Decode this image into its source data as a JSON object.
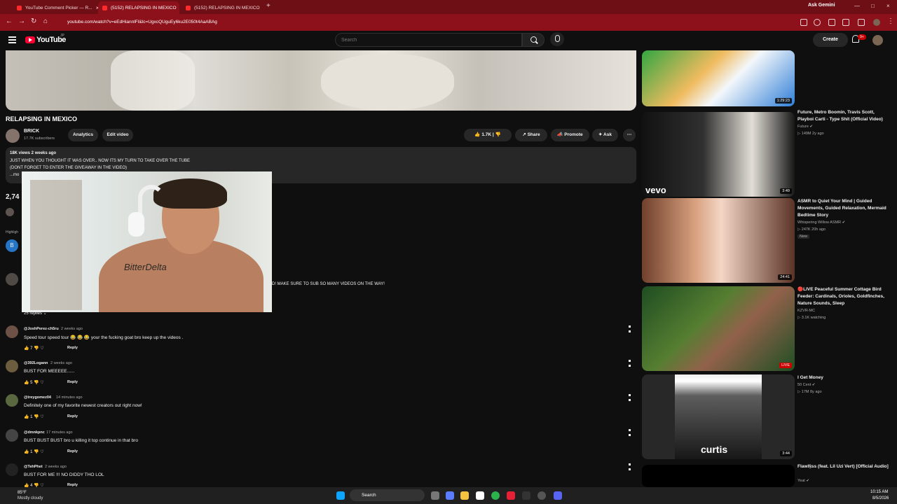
{
  "browser": {
    "tabs": [
      "YouTube Comment Picker — R...",
      "(5152) RELAPSING IN MEXICO",
      "(5152) RELAPSING IN MEXICO"
    ],
    "gemini": "Ask Gemini",
    "url": "youtube.com/watch?v=eEdHiannlFI&lc=UgxcQUguEy6ku2E050t4AaABAg",
    "new_tab": "+"
  },
  "youtube": {
    "logo": "YouTube",
    "logo_sup": "JP",
    "search_placeholder": "Search",
    "create": "Create",
    "notifications": "9+"
  },
  "video": {
    "title": "RELAPSING IN MEXICO",
    "channel": "BRICK",
    "subscribers": "17.7K subscribers",
    "actions": [
      "Analytics",
      "Edit video"
    ],
    "likes": "1.7K",
    "share": "Share",
    "promote": "Promote",
    "ask": "Ask"
  },
  "description": {
    "stats": "18K views  2 weeks ago",
    "line1": "JUST WHEN YOU THOUGHT IT WAS OVER.. NOW ITS MY TURN TO TAKE OVER THE TUBE",
    "line2": "(DONT FORGET TO ENTER THE GIVEAWAY IN THE VIDEO)",
    "more": "...mo"
  },
  "comments_fragment": {
    "count": "2,74",
    "highlighted": "Highligh",
    "avatar_letter": "B",
    "text": "D! MAKE SURE TO SUB SO MANY VIDEOS ON THE WAY!",
    "replies": "25 replies"
  },
  "comments": [
    {
      "author": "@JoshPerez-ch5ru",
      "time": "2 weeks ago",
      "text": "Speed tour speed tour 😂 😂 😂 your the fucking goat bro keep up the videos .",
      "likes": "7",
      "reply": "Reply"
    },
    {
      "author": "@392Logann",
      "time": "2 weeks ago",
      "text": "BUST FOR MEEEEE......",
      "likes": "5",
      "reply": "Reply"
    },
    {
      "author": "@treygomez04",
      "time": "14 minutes ago",
      "text": "Definitely one of my favorite newest creators out right now!",
      "likes": "1",
      "reply": "Reply"
    },
    {
      "author": "@dmnkpnc",
      "time": "17 minutes ago",
      "text": "BUST BUST BUST bro u killing it top continue in that bro",
      "likes": "1",
      "reply": "Reply"
    },
    {
      "author": "@TehPhet",
      "time": "2 weeks ago",
      "text": "BUST FOR ME !!! NO DIDDY THO LOL",
      "likes": "4",
      "reply": "Reply"
    }
  ],
  "recommendations": [
    {
      "title": "",
      "meta1": "",
      "meta2": "",
      "duration": "1:29:23"
    },
    {
      "title": "Future, Metro Boomin, Travis Scott, Playboi Carti - Type Shit (Official Video)",
      "meta1": "Future ✔",
      "meta2": "▷ 149M  2y ago",
      "duration": "3:49",
      "overlay": "vevo"
    },
    {
      "title": "ASMR to Quiet Your Mind | Guided Movements, Guided Relaxation, Mermaid Bedtime Story",
      "meta1": "Whispering Willow ASMR ✔",
      "meta2": "▷ 247K  20h ago",
      "duration": "24:41",
      "badge": "New"
    },
    {
      "title": "🔴LIVE Peaceful Summer Cottage Bird Feeder: Cardinals, Orioles, Goldfinches, Nature Sounds, Sleep",
      "meta1": "KZVR-MC",
      "meta2": "▷ 3.1K watching",
      "duration": "LIVE"
    },
    {
      "title": "I Get Money",
      "meta1": "50 Cent ✔",
      "meta2": "▷ 17M  8y ago",
      "duration": "3:44",
      "overlay": "curtis"
    },
    {
      "title": "Flawl§ss (feat. Lil Uzi Vert) [Official Audio]",
      "meta1": "Yeat ✔",
      "meta2": "",
      "duration": ""
    }
  ],
  "taskbar": {
    "weather": "85°F",
    "condition": "Mostly cloudy",
    "search": "Search",
    "time": "10:15 AM",
    "date": "8/5/2026"
  }
}
